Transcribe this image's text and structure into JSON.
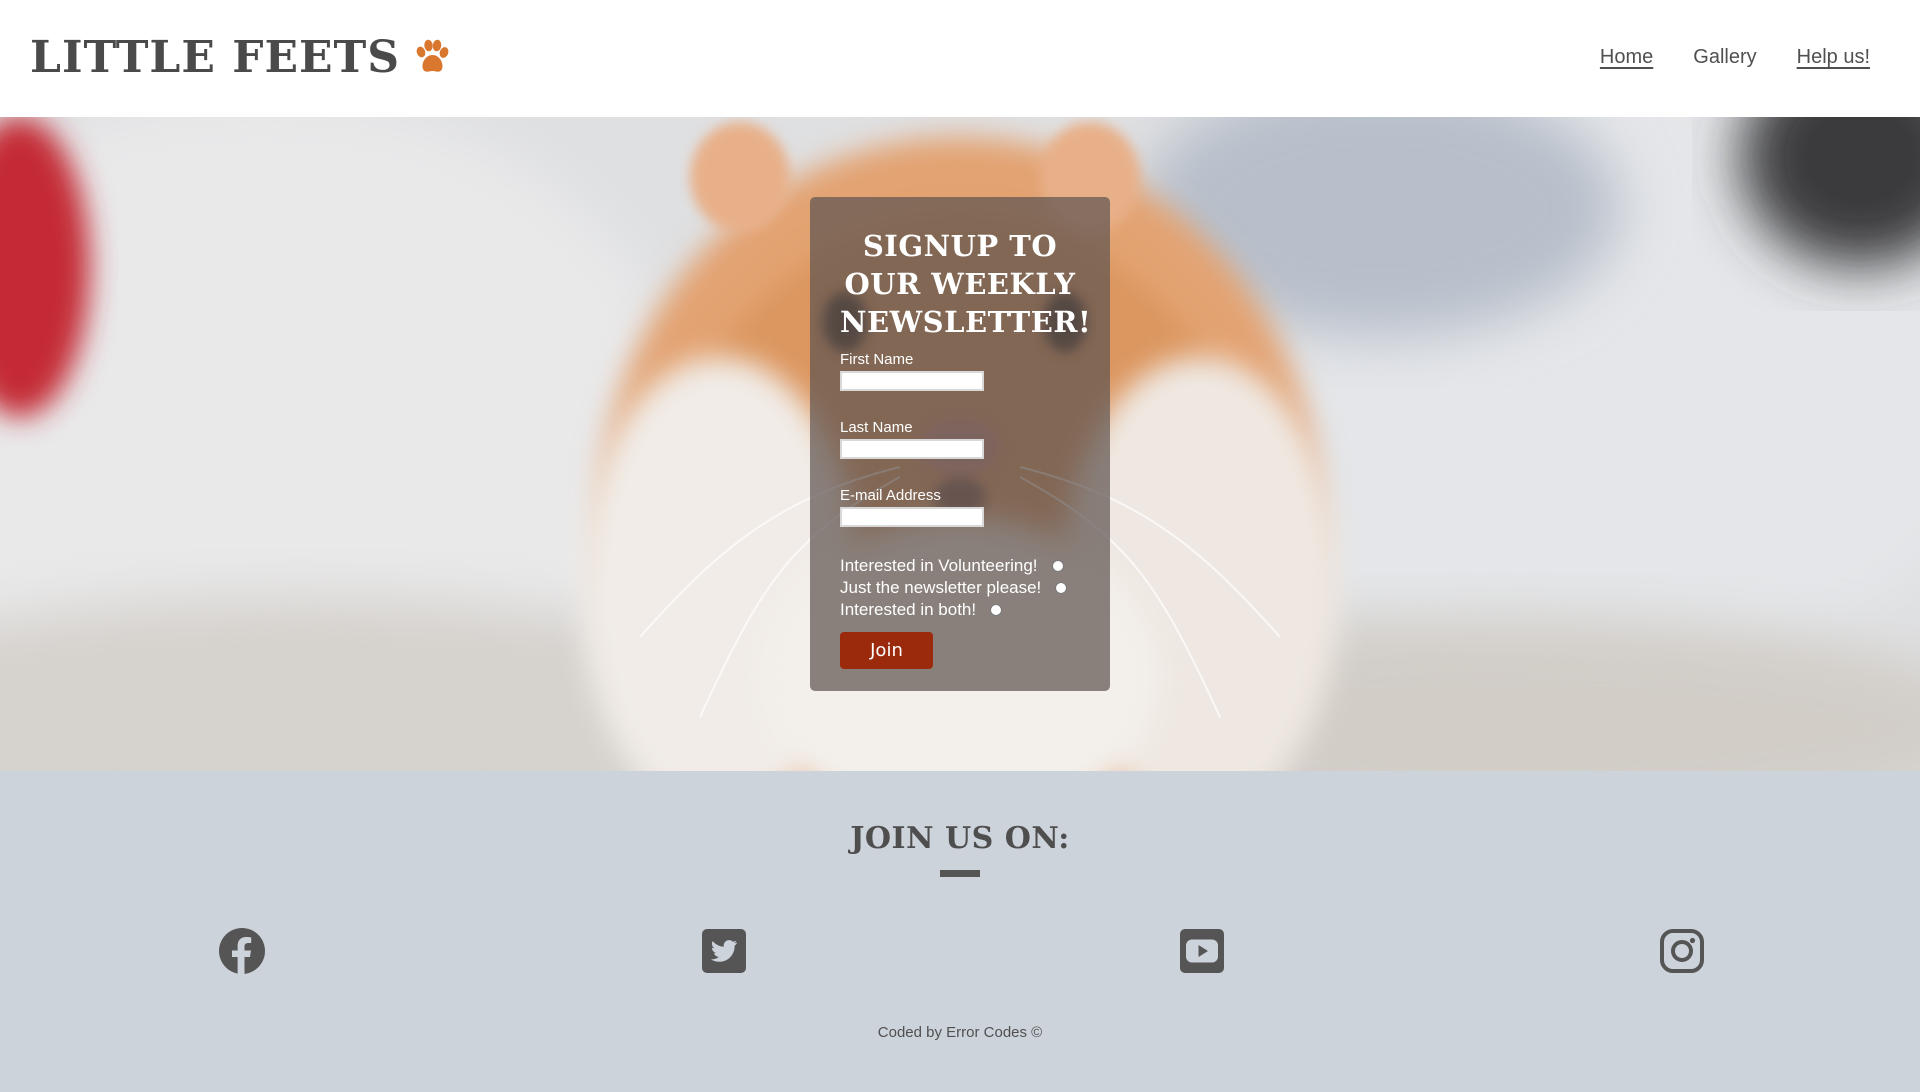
{
  "header": {
    "brand_title": "LITTLE FEETS",
    "brand_icon": "paw-icon",
    "brand_icon_color": "#d9772f",
    "nav": {
      "home": "Home",
      "gallery": "Gallery",
      "help": "Help us!"
    }
  },
  "hero": {
    "background": "blurred photo of an orange and white hamster facing the camera",
    "signup": {
      "title": "SIGNUP TO OUR WEEKLY NEWSLETTER!",
      "first_name_label": "First Name",
      "first_name_value": "",
      "last_name_label": "Last Name",
      "last_name_value": "",
      "email_label": "E-mail Address",
      "email_value": "",
      "options": [
        "Interested in Volunteering!",
        "Just the newsletter please!",
        "Interested in both!"
      ],
      "join_label": "Join",
      "join_color": "#9b2a0c"
    }
  },
  "footer": {
    "title": "JOIN US ON:",
    "social": [
      "facebook-icon",
      "twitter-icon",
      "youtube-icon",
      "instagram-icon"
    ],
    "icon_color": "#555555",
    "copyright": "Coded by Error Codes ©"
  }
}
